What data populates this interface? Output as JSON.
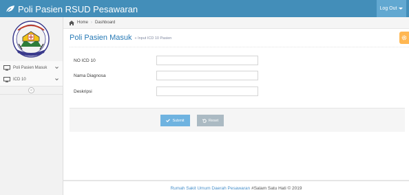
{
  "navbar": {
    "brand": "Poli Pasien RSUD Pesawaran",
    "logout_label": "Log Out",
    "brand_icon": "leaf-icon"
  },
  "sidebar": {
    "items": [
      {
        "label": "Poli Pasien Masuk",
        "icon": "desktop-icon"
      },
      {
        "label": "ICD 10",
        "icon": "desktop-icon"
      }
    ],
    "collapse_glyph": "«"
  },
  "breadcrumb": {
    "home": "Home",
    "current": "Dashboard"
  },
  "page": {
    "title": "Poli Pasien Masuk",
    "subtitle": "» Input ICD 10 Pasien"
  },
  "form": {
    "fields": [
      {
        "label": "NO ICD 10",
        "value": "",
        "placeholder": ""
      },
      {
        "label": "Nama Diagnosa",
        "value": "",
        "placeholder": ""
      },
      {
        "label": "Deskripsi",
        "value": "",
        "placeholder": ""
      }
    ],
    "submit_label": "Submit",
    "reset_label": "Reset"
  },
  "footer": {
    "org": "Rumah Sakit Umum Daerah Pesawaran",
    "tagline": "#Salam Satu Hati © 2019"
  },
  "colors": {
    "navbar": "#438eb9",
    "accent": "#2679b5",
    "submit": "#6fb3e0",
    "reset": "#abbac3",
    "settings_tab": "#ffb752"
  }
}
